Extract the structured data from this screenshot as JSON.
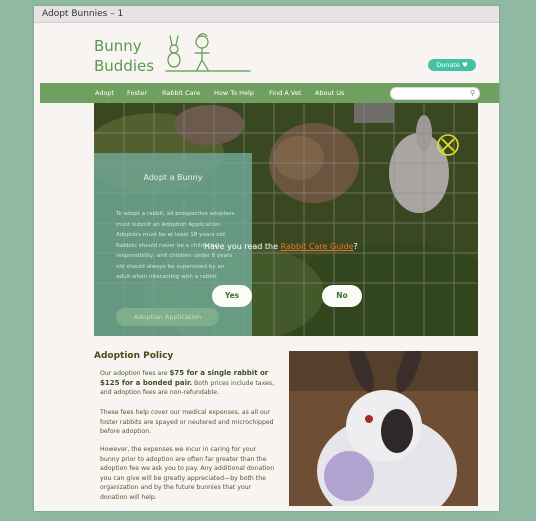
{
  "window": {
    "title": "Adopt Bunnies – 1"
  },
  "header": {
    "logo_line1": "Bunny",
    "logo_line2": "Buddies",
    "donate_label": "Donate"
  },
  "nav": {
    "items": [
      "Adopt",
      "Foster",
      "Rabbit Care",
      "How To Help",
      "Find A Vet",
      "About Us"
    ],
    "search_placeholder": ""
  },
  "hero": {
    "panel_title": "Adopt a Bunny",
    "panel_text": "To adopt a rabbit, all prospective adopters must submit an Adoption Application. Adopters must be at least 18 years old. Rabbits should never be a child's full responsibility, and children under 8 years old should always be supervised by an adult when interacting with a rabbit.",
    "panel_button": "Adoption Application"
  },
  "modal": {
    "question_prefix": "Have you read the ",
    "question_link": "Rabbit Care Guide",
    "question_suffix": "?",
    "yes_label": "Yes",
    "no_label": "No"
  },
  "policy": {
    "title": "Adoption Policy",
    "p1_intro": "Our adoption fees are ",
    "p1_bold": "$75 for a single rabbit or $125 for a bonded pair.",
    "p1_rest": " Both prices include taxes, and adoption fees are non-refundable.",
    "p2": "These fees help cover our medical expenses, as all our foster rabbits are spayed or neutered and microchipped before adoption.",
    "p3": "However, the expenses we incur in caring for your bunny prior to adoption are often far greater than the adoption fee we ask you to pay. Any additional donation you can give will be greatly appreciated—by both the organization and by the future bunnies that your donation will help."
  },
  "colors": {
    "accent": "#6fa060",
    "donate": "#44c1a4",
    "link": "#e8772b",
    "panel": "#70aa96",
    "background": "#8fb9a2"
  }
}
